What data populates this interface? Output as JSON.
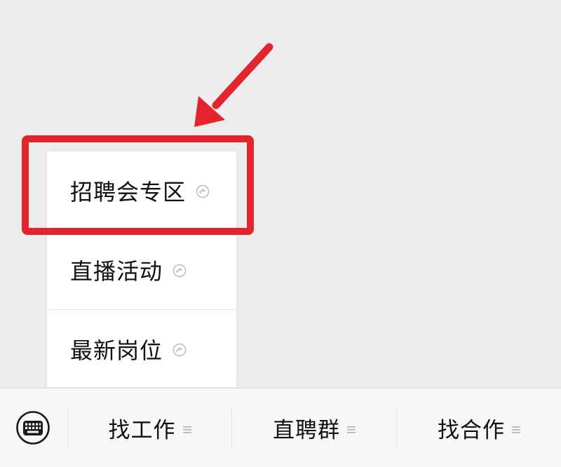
{
  "colors": {
    "background": "#ededed",
    "highlight": "#e3252b",
    "text": "#111111",
    "icon_gray": "#b8b8b8"
  },
  "popup_menu": {
    "items": [
      {
        "label": "招聘会专区",
        "icon": "mini-program-icon"
      },
      {
        "label": "直播活动",
        "icon": "mini-program-icon"
      },
      {
        "label": "最新岗位",
        "icon": "mini-program-icon"
      }
    ]
  },
  "bottom_bar": {
    "keyboard_icon": "keyboard-icon",
    "tabs": [
      {
        "label": "找工作",
        "icon": "menu-lines-icon"
      },
      {
        "label": "直聘群",
        "icon": "menu-lines-icon"
      },
      {
        "label": "找合作",
        "icon": "menu-lines-icon"
      }
    ]
  }
}
